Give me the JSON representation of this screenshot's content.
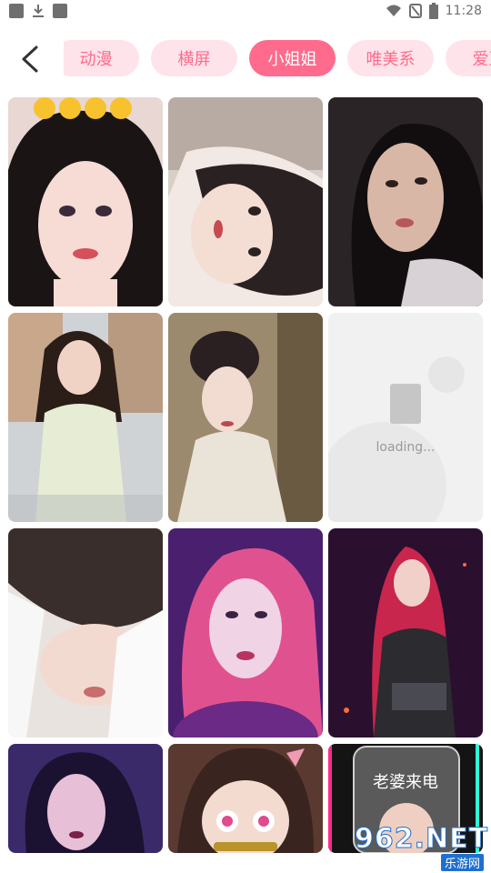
{
  "status_bar": {
    "time": "11:28",
    "icons": [
      "notification-icon",
      "download-icon",
      "app-icon",
      "wifi-icon",
      "no-sim-icon",
      "battery-icon"
    ]
  },
  "header": {
    "back_icon": "chevron-left-icon",
    "tabs": [
      {
        "label": "动漫"
      },
      {
        "label": "横屏"
      },
      {
        "label": "小姐姐"
      },
      {
        "label": "唯美系"
      },
      {
        "label": "爱豆"
      }
    ],
    "active_tab": "小姐姐"
  },
  "grid": {
    "items": [
      {
        "type": "image",
        "desc": "girl-portrait-emoji"
      },
      {
        "type": "image",
        "desc": "girl-braids-lying"
      },
      {
        "type": "image",
        "desc": "girl-dark-hair"
      },
      {
        "type": "image",
        "desc": "girl-white-dress-street"
      },
      {
        "type": "image",
        "desc": "girl-vintage-veil"
      },
      {
        "type": "loading",
        "text": "loading..."
      },
      {
        "type": "image",
        "desc": "girl-rotated-white-shirt"
      },
      {
        "type": "image",
        "desc": "girl-pink-hair-art"
      },
      {
        "type": "image",
        "desc": "girl-red-hair-stage"
      },
      {
        "type": "image",
        "desc": "girl-purple-light"
      },
      {
        "type": "image",
        "desc": "anime-girl-nezuko"
      },
      {
        "type": "image",
        "desc": "phone-call-girl",
        "overlay": "老婆来电"
      }
    ]
  },
  "watermark": {
    "top": "962.NET",
    "bottom": "乐游网"
  },
  "colors": {
    "accent": "#ff6b8c",
    "tab_bg": "#ffe3ea"
  }
}
